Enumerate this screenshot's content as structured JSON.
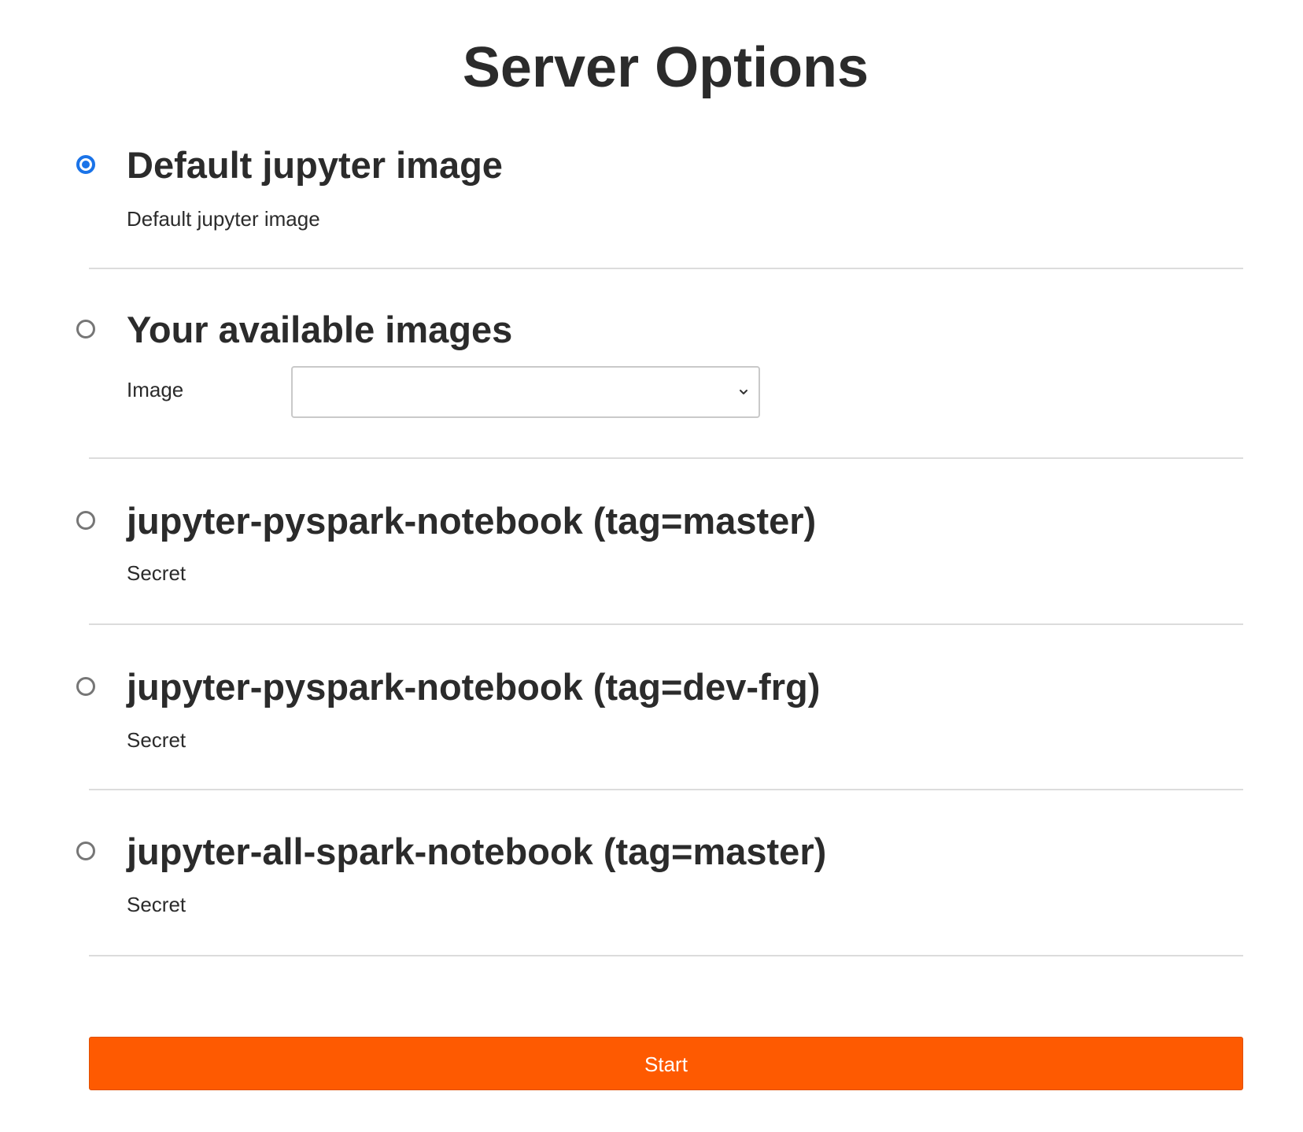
{
  "page": {
    "title": "Server Options"
  },
  "options": [
    {
      "title": "Default jupyter image",
      "description": "Default jupyter image",
      "selected": true
    },
    {
      "title": "Your available images",
      "field_label": "Image",
      "select_value": "",
      "selected": false
    },
    {
      "title": "jupyter-pyspark-notebook (tag=master)",
      "description": "Secret",
      "selected": false
    },
    {
      "title": "jupyter-pyspark-notebook (tag=dev-frg)",
      "description": "Secret",
      "selected": false
    },
    {
      "title": "jupyter-all-spark-notebook (tag=master)",
      "description": "Secret",
      "selected": false
    }
  ],
  "icons": {
    "select_arrow": "chevron-down-icon"
  },
  "colors": {
    "accent_radio": "#1a73e8",
    "start_button": "#fe5a01",
    "divider": "#dcdcdc"
  },
  "actions": {
    "start_label": "Start"
  }
}
